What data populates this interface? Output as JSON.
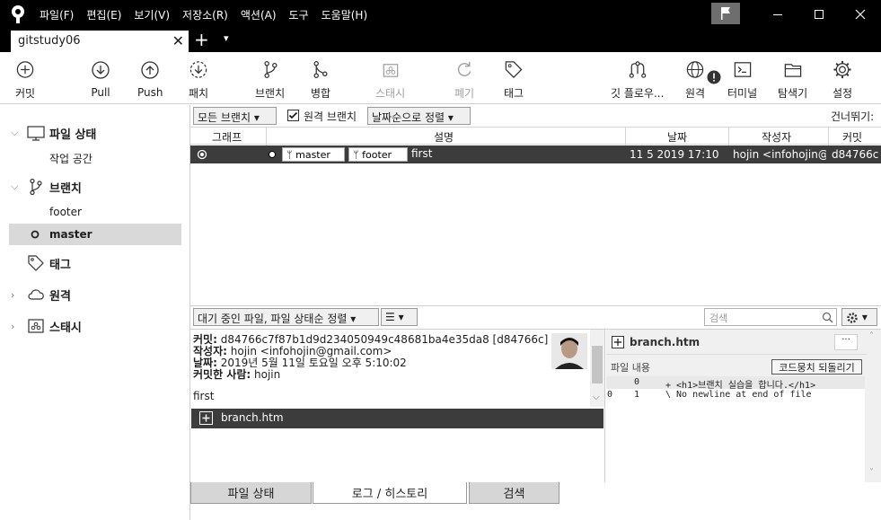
{
  "menu": [
    "파일(F)",
    "편집(E)",
    "보기(V)",
    "저장소(R)",
    "액션(A)",
    "도구",
    "도움말(H)"
  ],
  "tab": {
    "title": "gitstudy06",
    "close": "✕",
    "add": "+",
    "dropdown": "▾"
  },
  "toolbar": {
    "commit": "커밋",
    "pull": "Pull",
    "push": "Push",
    "fetch": "패치",
    "branch": "브랜치",
    "merge": "병합",
    "stash": "스태시",
    "discard": "폐기",
    "tag": "태그",
    "gitflow": "깃 플로우...",
    "remote": "원격",
    "terminal": "터미널",
    "explorer": "탐색기",
    "settings": "설정"
  },
  "sidebar": {
    "file_status": "파일 상태",
    "working_copy": "작업 공간",
    "branches": "브랜치",
    "branch_items": [
      "footer",
      "master"
    ],
    "tags": "태그",
    "remotes": "원격",
    "stashes": "스태시"
  },
  "filter": {
    "all_branches": "모든 브랜치 ▾",
    "remote_branches": "원격 브랜치",
    "sort": "날짜순으로 정렬 ▾",
    "jump": "건너뛰기:"
  },
  "table": {
    "headers": [
      "그래프",
      "설명",
      "날짜",
      "작성자",
      "커밋"
    ],
    "rows": [
      {
        "tags": [
          "master",
          "footer"
        ],
        "message": "first",
        "date": "11 5 2019 17:10",
        "author": "hojin <infohojin@",
        "commit": "d84766c"
      }
    ]
  },
  "lower": {
    "staging_sort": "대기 중인 파일, 파일 상태순 정렬 ▾",
    "search_placeholder": "검색"
  },
  "detail": {
    "commit_label": "커밋:",
    "commit_value": "d84766c7f87b1d9d234050949c48681ba4e35da8 [d84766c]",
    "author_label": "작성자:",
    "author_value": "hojin <infohojin@gmail.com>",
    "date_label": "날짜:",
    "date_value": "2019년 5월 11일 토요일 오후 5:10:02",
    "committer_label": "커밋한 사람:",
    "committer_value": "hojin",
    "message": "first"
  },
  "files": [
    "branch.htm"
  ],
  "diff": {
    "filename": "branch.htm",
    "more": "···",
    "content_label": "파일 내용",
    "revert_button": "코드뭉치 되돌리기",
    "lines": [
      {
        "old": "",
        "new": "0",
        "text": "+ <h1>브랜치 실습을 합니다.</h1>"
      },
      {
        "old": "0",
        "new": "1",
        "text": "\\  No newline at end of file"
      }
    ]
  },
  "bottom_tabs": [
    "파일 상태",
    "로그 / 히스토리",
    "검색"
  ]
}
